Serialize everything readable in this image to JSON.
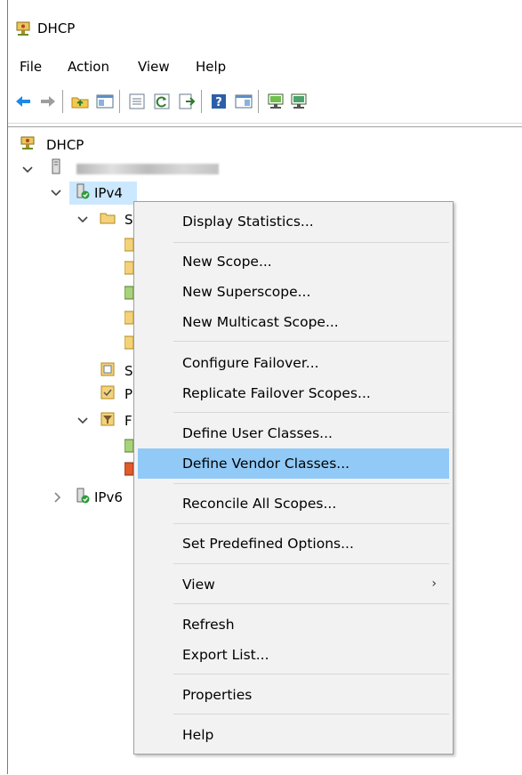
{
  "window": {
    "title": "DHCP"
  },
  "menubar": {
    "items": [
      "File",
      "Action",
      "View",
      "Help"
    ]
  },
  "toolbar": {
    "icons": [
      "back-icon",
      "forward-icon",
      "up-folder-icon",
      "show-hide-tree-icon",
      "properties-icon",
      "refresh-icon",
      "export-icon",
      "help-icon",
      "action-pane-icon",
      "authorize-server-icon",
      "unauthorize-server-icon"
    ]
  },
  "tree": {
    "root": "DHCP",
    "server": "",
    "ipv4": "IPv4",
    "scope_partial": "S",
    "server_options_partial": "S",
    "policies_partial": "P",
    "filters_partial": "F",
    "ipv6": "IPv6"
  },
  "context_menu": {
    "items": [
      {
        "label": "Display Statistics..."
      },
      {
        "label": "New Scope..."
      },
      {
        "label": "New Superscope..."
      },
      {
        "label": "New Multicast Scope..."
      },
      {
        "label": "Configure Failover..."
      },
      {
        "label": "Replicate Failover Scopes..."
      },
      {
        "label": "Define User Classes..."
      },
      {
        "label": "Define Vendor Classes...",
        "highlighted": true
      },
      {
        "label": "Reconcile All Scopes..."
      },
      {
        "label": "Set Predefined Options..."
      },
      {
        "label": "View",
        "submenu": true
      },
      {
        "label": "Refresh"
      },
      {
        "label": "Export List..."
      },
      {
        "label": "Properties"
      },
      {
        "label": "Help"
      }
    ],
    "submenu_arrow": "›"
  },
  "colors": {
    "highlight": "#91c9f7",
    "selection": "#cce8ff",
    "menu_bg": "#f2f2f2"
  }
}
